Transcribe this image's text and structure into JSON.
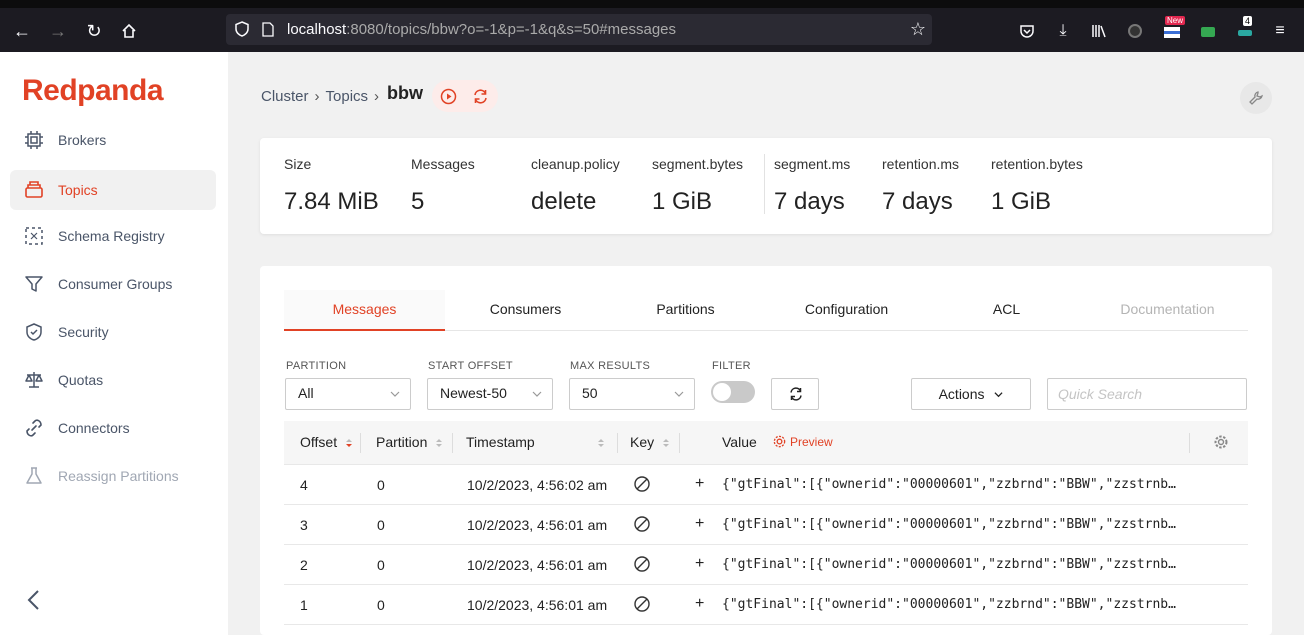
{
  "browser": {
    "url_host": "localhost",
    "url_rest": ":8080/topics/bbw?o=-1&p=-1&q&s=50#messages",
    "new_badge": "New",
    "ext_count": "4"
  },
  "app": {
    "logo": "Redpanda"
  },
  "sidebar": {
    "items": [
      {
        "label": "Brokers",
        "icon": "server-icon"
      },
      {
        "label": "Topics",
        "icon": "stack-icon",
        "active": true
      },
      {
        "label": "Schema Registry",
        "icon": "schema-icon"
      },
      {
        "label": "Consumer Groups",
        "icon": "funnel-icon"
      },
      {
        "label": "Security",
        "icon": "shield-icon"
      },
      {
        "label": "Quotas",
        "icon": "scale-icon"
      },
      {
        "label": "Connectors",
        "icon": "link-icon"
      },
      {
        "label": "Reassign Partitions",
        "icon": "beaker-icon",
        "disabled": true
      }
    ]
  },
  "breadcrumb": {
    "cluster": "Cluster",
    "topics": "Topics",
    "current": "bbw"
  },
  "stats": [
    {
      "key": "Size",
      "value": "7.84 MiB"
    },
    {
      "key": "Messages",
      "value": "5"
    },
    {
      "key": "cleanup.policy",
      "value": "delete"
    },
    {
      "key": "segment.bytes",
      "value": "1 GiB"
    },
    {
      "key": "segment.ms",
      "value": "7 days"
    },
    {
      "key": "retention.ms",
      "value": "7 days"
    },
    {
      "key": "retention.bytes",
      "value": "1 GiB"
    }
  ],
  "tabs": [
    "Messages",
    "Consumers",
    "Partitions",
    "Configuration",
    "ACL",
    "Documentation"
  ],
  "filters": {
    "partition_label": "PARTITION",
    "partition_value": "All",
    "start_offset_label": "START OFFSET",
    "start_offset_value": "Newest-50",
    "max_results_label": "MAX RESULTS",
    "max_results_value": "50",
    "filter_label": "FILTER",
    "actions_label": "Actions",
    "quick_search_placeholder": "Quick Search"
  },
  "table": {
    "headers": {
      "offset": "Offset",
      "partition": "Partition",
      "timestamp": "Timestamp",
      "key": "Key",
      "value": "Value",
      "preview": "Preview"
    },
    "rows": [
      {
        "offset": "4",
        "partition": "0",
        "timestamp": "10/2/2023, 4:56:02 am",
        "value": "{\"gtFinal\":[{\"ownerid\":\"00000601\",\"zzbrnd\":\"BBW\",\"zzstrnbr\":"
      },
      {
        "offset": "3",
        "partition": "0",
        "timestamp": "10/2/2023, 4:56:01 am",
        "value": "{\"gtFinal\":[{\"ownerid\":\"00000601\",\"zzbrnd\":\"BBW\",\"zzstrnbr\":"
      },
      {
        "offset": "2",
        "partition": "0",
        "timestamp": "10/2/2023, 4:56:01 am",
        "value": "{\"gtFinal\":[{\"ownerid\":\"00000601\",\"zzbrnd\":\"BBW\",\"zzstrnbr\":"
      },
      {
        "offset": "1",
        "partition": "0",
        "timestamp": "10/2/2023, 4:56:01 am",
        "value": "{\"gtFinal\":[{\"ownerid\":\"00000601\",\"zzbrnd\":\"BBW\",\"zzstrnbr\":"
      }
    ]
  },
  "colors": {
    "brand": "#e14225",
    "muted": "#4a5568"
  }
}
